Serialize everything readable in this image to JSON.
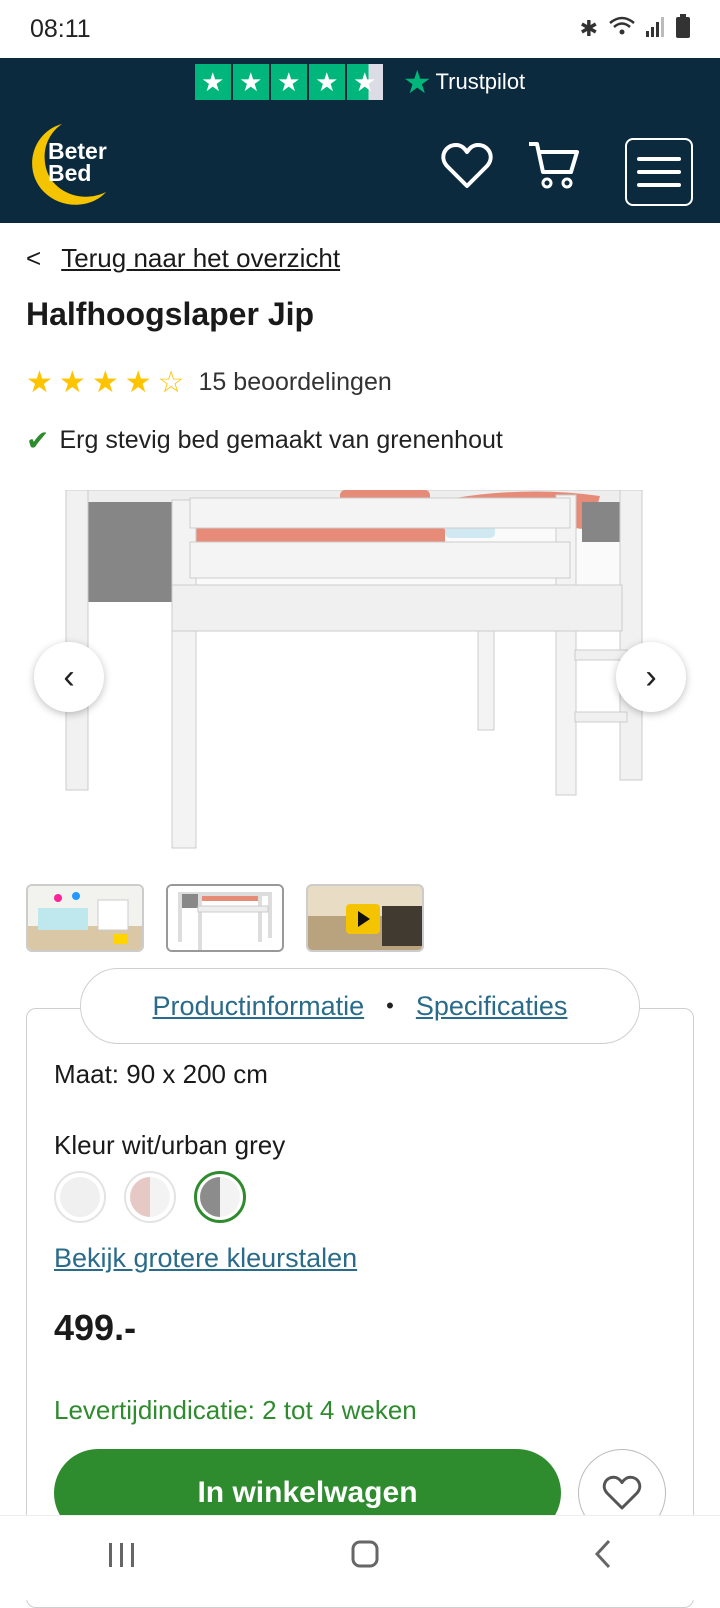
{
  "status_bar": {
    "time": "08:11"
  },
  "trustpilot": {
    "label": "Trustpilot",
    "stars": 4.5
  },
  "brand": {
    "line1": "Beter",
    "line2": "Bed"
  },
  "back_link": {
    "label": "Terug naar het overzicht"
  },
  "product": {
    "title": "Halfhoogslaper Jip",
    "rating": 4,
    "reviews": "15 beoordelingen",
    "usp": "Erg stevig bed gemaakt van grenenhout"
  },
  "tabs": {
    "info": "Productinformatie",
    "specs": "Specificaties"
  },
  "details": {
    "size": "Maat: 90 x 200 cm",
    "color_label": "Kleur wit/urban grey",
    "bigger_swatches": "Bekijk grotere kleurstalen",
    "price": "499.-",
    "delivery": "Levertijdindicatie: 2 tot 4 weken",
    "cart_button": "In winkelwagen"
  },
  "swatches": [
    {
      "name": "wit",
      "color": "#f0f0f0"
    },
    {
      "name": "wit/roze",
      "color": "#e6c9c4"
    },
    {
      "name": "wit/urban grey",
      "color": "#8c8c8c",
      "selected": true
    }
  ],
  "colors": {
    "navy": "#0c2a3e",
    "green": "#2e8b2e",
    "link": "#2a6b8a",
    "trustpilot": "#00b67a"
  }
}
